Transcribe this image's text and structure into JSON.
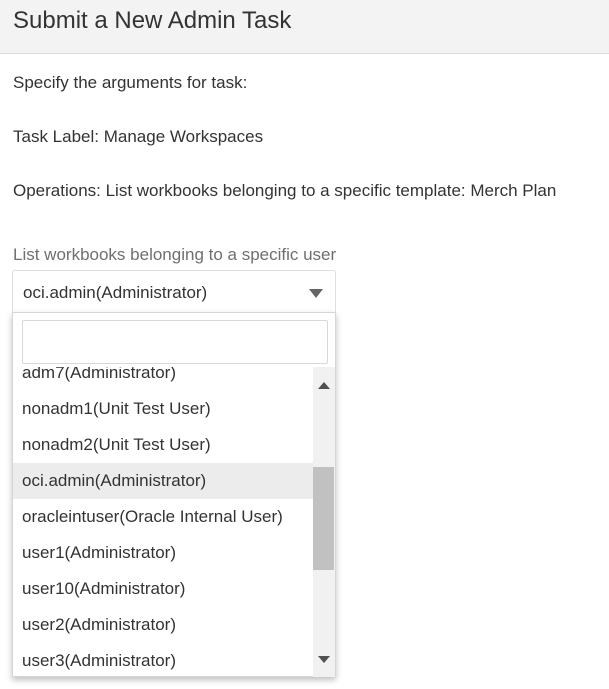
{
  "dialog": {
    "title": "Submit a New Admin Task",
    "instruction": "Specify the arguments for task:",
    "task_label": "Task Label: Manage Workspaces",
    "operations": "Operations: List workbooks belonging to a specific template: Merch Plan"
  },
  "user_select": {
    "label": "List workbooks belonging to a specific user",
    "selected_value": "oci.admin(Administrator)",
    "search_value": "",
    "options": [
      "adm7(Administrator)",
      "nonadm1(Unit Test User)",
      "nonadm2(Unit Test User)",
      "oci.admin(Administrator)",
      "oracleintuser(Oracle Internal User)",
      "user1(Administrator)",
      "user10(Administrator)",
      "user2(Administrator)",
      "user3(Administrator)"
    ],
    "highlighted_option": "oci.admin(Administrator)"
  },
  "icons": {
    "search": "search-icon",
    "dropdown": "caret-down-icon"
  },
  "colors": {
    "header_bg": "#f3f3f3",
    "selected_row_bg": "#ececec",
    "label_gray": "#6f6f6f"
  }
}
